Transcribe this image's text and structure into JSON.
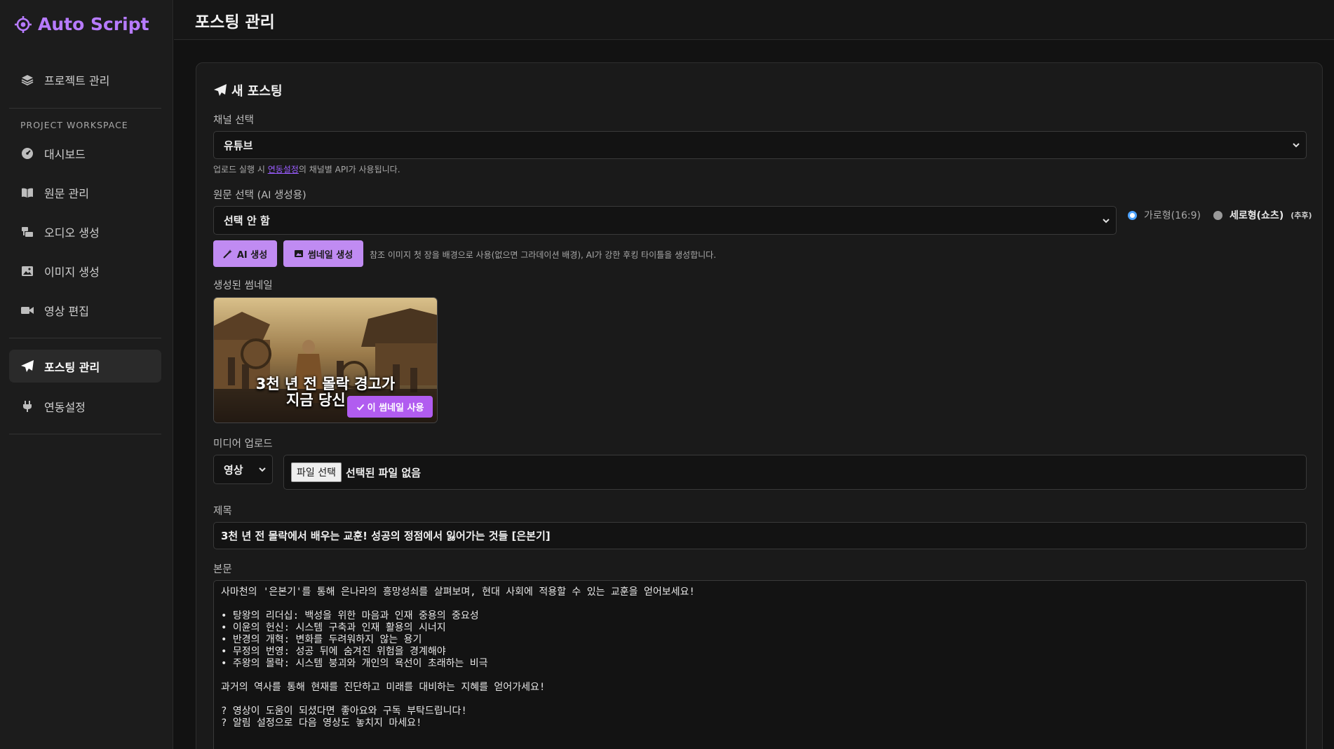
{
  "brand": {
    "name": "Auto Script"
  },
  "nav": {
    "projects": "프로젝트 관리",
    "section": "PROJECT WORKSPACE",
    "dashboard": "대시보드",
    "source": "원문 관리",
    "audio": "오디오 생성",
    "image": "이미지 생성",
    "video": "영상 편집",
    "posting": "포스팅 관리",
    "integration": "연동설정"
  },
  "header": {
    "title": "포스팅 관리"
  },
  "form": {
    "card_title": "새 포스팅",
    "channel_label": "채널 선택",
    "channel_value": "유튜브",
    "channel_hint_pre": "업로드 실행 시 ",
    "channel_hint_link": "연동설정",
    "channel_hint_post": "의 채널별 API가 사용됩니다.",
    "source_label": "원문 선택 (AI 생성용)",
    "source_value": "선택 안 함",
    "orientation_landscape": "가로형(16:9)",
    "orientation_portrait": "세로형(쇼츠)",
    "orientation_portrait_note": "(추후)",
    "ai_button": "AI 생성",
    "thumb_button": "썸네일 생성",
    "thumb_hint": "참조 이미지 첫 장을 배경으로 사용(없으면 그라데이션 배경), AI가 강한 후킹 타이틀을 생성합니다.",
    "generated_label": "생성된 썸네일",
    "thumb_caption_1": "3천 년 전 몰락 경고가",
    "thumb_caption_2": "지금 당신",
    "use_thumb_button": "이 썸네일 사용",
    "media_label": "미디어 업로드",
    "media_type": "영상",
    "file_button": "파일 선택",
    "file_status": "선택된 파일 없음",
    "title_label": "제목",
    "title_value": "3천 년 전 몰락에서 배우는 교훈! 성공의 정점에서 잃어가는 것들 [은본기]",
    "body_label": "본문",
    "body_value": "사마천의 '은본기'를 통해 은나라의 흥망성쇠를 살펴보며, 현대 사회에 적용할 수 있는 교훈을 얻어보세요!\n\n• 탕왕의 리더십: 백성을 위한 마음과 인재 중용의 중요성\n• 이윤의 헌신: 시스템 구축과 인재 활용의 시너지\n• 반경의 개혁: 변화를 두려워하지 않는 용기\n• 무정의 번영: 성공 뒤에 숨겨진 위험을 경계해야\n• 주왕의 몰락: 시스템 붕괴와 개인의 욕선이 초래하는 비극\n\n과거의 역사를 통해 현재를 진단하고 미래를 대비하는 지혜를 얻어가세요!\n\n? 영상이 도움이 되셨다면 좋아요와 구독 부탁드립니다!\n? 알림 설정으로 다음 영상도 놓치지 마세요!"
  },
  "colors": {
    "accent": "#b77bff",
    "button": "#c08bf2",
    "use_button": "#b15cf0",
    "radio_on": "#4da3ff"
  }
}
